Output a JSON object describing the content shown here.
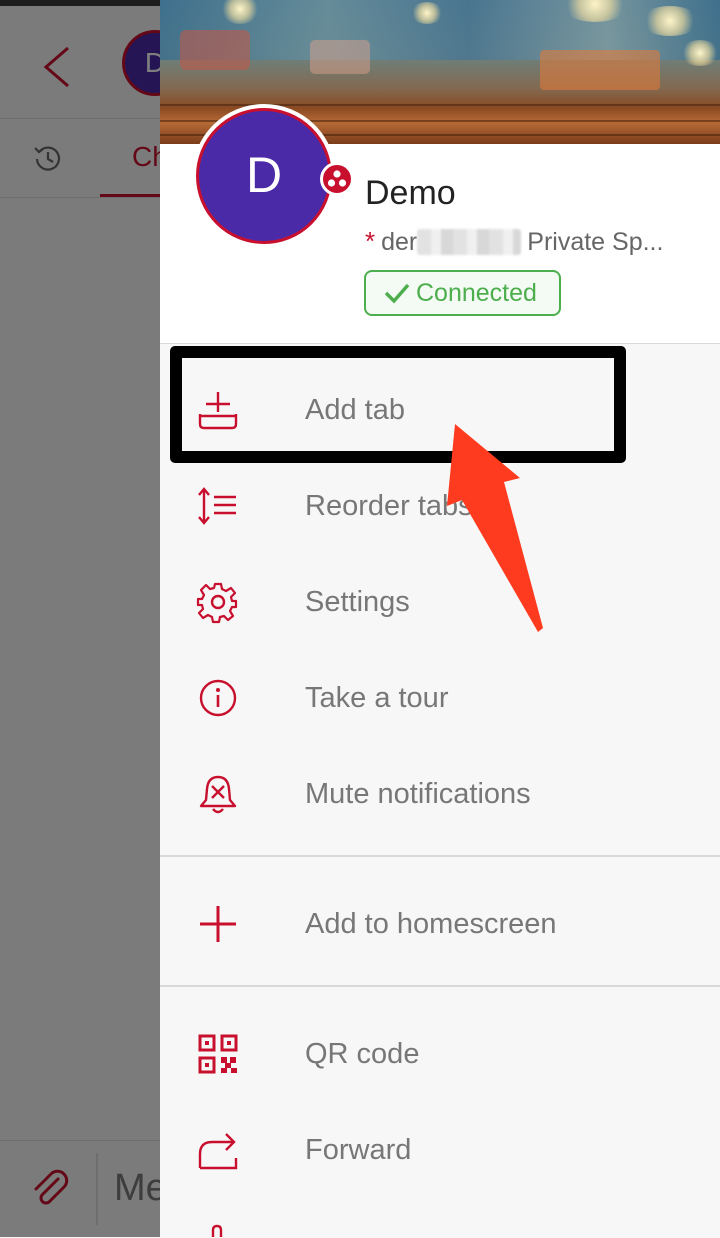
{
  "background": {
    "avatar_letter": "D",
    "active_tab_label": "Ch",
    "message_placeholder": "Me"
  },
  "profile": {
    "avatar_letter": "D",
    "name": "Demo",
    "space_prefix": "der",
    "space_suffix": "Private Sp...",
    "status": "Connected"
  },
  "menu": {
    "groups": [
      [
        {
          "label": "Add tab",
          "icon": "add-tab-icon"
        },
        {
          "label": "Reorder tabs",
          "icon": "reorder-icon"
        },
        {
          "label": "Settings",
          "icon": "gear-icon"
        },
        {
          "label": "Take a tour",
          "icon": "info-icon"
        },
        {
          "label": "Mute notifications",
          "icon": "bell-mute-icon"
        }
      ],
      [
        {
          "label": "Add to homescreen",
          "icon": "plus-icon"
        }
      ],
      [
        {
          "label": "QR code",
          "icon": "qr-code-icon"
        },
        {
          "label": "Forward",
          "icon": "forward-icon"
        }
      ]
    ]
  },
  "colors": {
    "accent": "#c8102e",
    "avatar": "#4b2aa8",
    "connected": "#4cae4c",
    "annotation_arrow": "#ff3b1f",
    "annotation_box": "#000000"
  }
}
